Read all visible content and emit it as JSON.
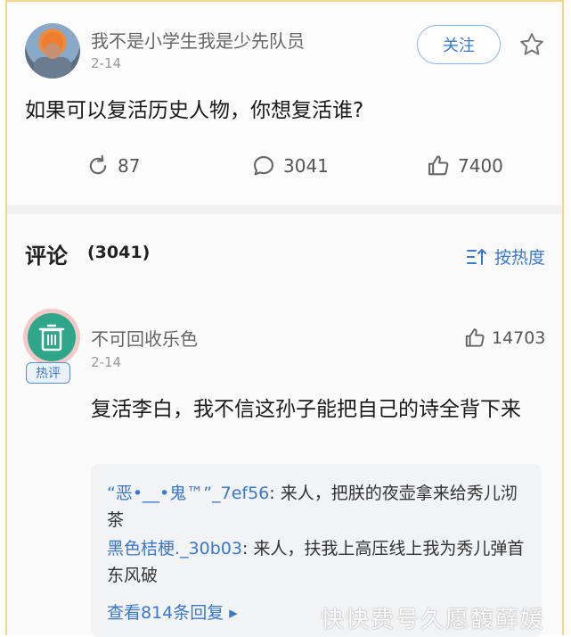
{
  "post": {
    "username": "我不是小学生我是少先队员",
    "date": "2-14",
    "follow_label": "关注",
    "question": "如果可以复活历史人物，你想复活谁?",
    "stats": {
      "shares": "87",
      "comments": "3041",
      "likes": "7400"
    }
  },
  "comments_header": {
    "title": "评论",
    "count": "(3041)",
    "sort_label": "按热度"
  },
  "comment": {
    "username": "不可回收乐色",
    "date": "2-14",
    "badge": "热评",
    "likes": "14703",
    "text": "复活李白，我不信这孙子能把自己的诗全背下来",
    "replies": [
      {
        "name": "“恶•__•鬼™”_7ef56",
        "text": ": 来人，把朕的夜壶拿来给秀儿沏茶"
      },
      {
        "name": "黑色桔梗._30b03",
        "text": ": 来人，扶我上高压线上我为秀儿弹首东风破"
      }
    ],
    "view_more": "查看814条回复 ▸"
  },
  "watermark": "快快费号久愿馥藓媛",
  "colors": {
    "accent": "#3a78c9",
    "frame": "#f4d78a",
    "avatar_green": "#2fa68a"
  },
  "icons": [
    "star-icon",
    "repost-icon",
    "comment-icon",
    "thumbs-up-icon",
    "sort-icon",
    "trash-icon"
  ]
}
